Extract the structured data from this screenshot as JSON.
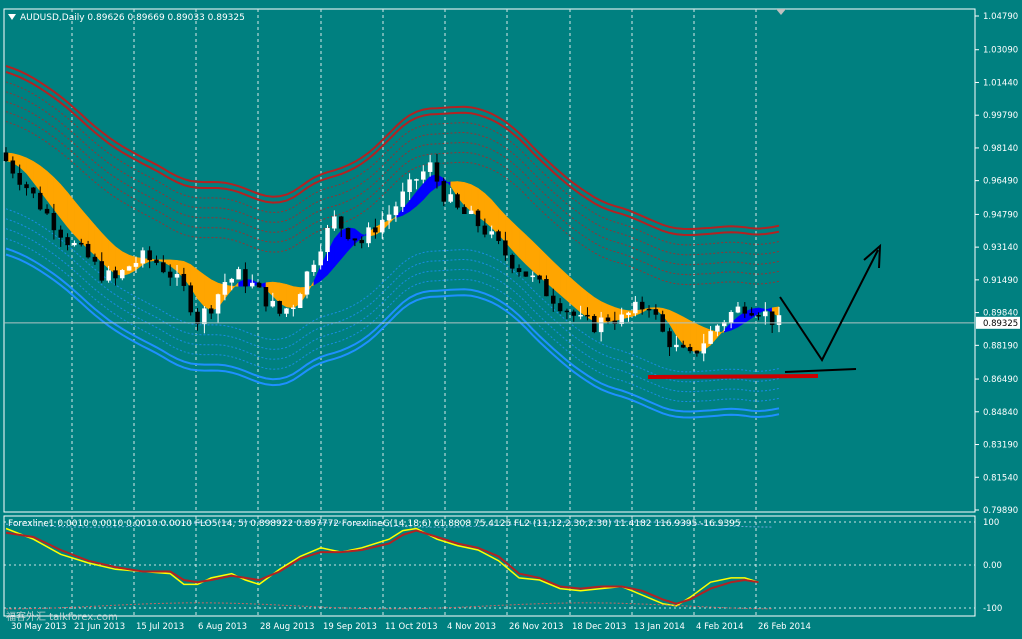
{
  "chart_data": [
    {
      "type": "candlestick",
      "symbol": "AUDUSD,Daily",
      "ohlc_text": "0.89626 0.89669 0.89033 0.89325",
      "current_price": "0.89325",
      "y_tick_labels": [
        "1.04790",
        "1.03090",
        "1.01440",
        "0.99790",
        "0.98140",
        "0.96490",
        "0.94790",
        "0.93140",
        "0.91490",
        "0.89840",
        "0.88190",
        "0.86490",
        "0.84840",
        "0.83190",
        "0.81540",
        "0.79890"
      ],
      "ylim": [
        0.7989,
        1.0479
      ],
      "x_tick_labels": [
        "30 May 2013",
        "21 Jun 2013",
        "15 Jul 2013",
        "6 Aug 2013",
        "28 Aug 2013",
        "19 Sep 2013",
        "11 Oct 2013",
        "4 Nov 2013",
        "26 Nov 2013",
        "18 Dec 2013",
        "13 Jan 2014",
        "4 Feb 2014",
        "26 Feb 2014"
      ],
      "close_path": [
        [
          0,
          0.975
        ],
        [
          3,
          0.962
        ],
        [
          6,
          0.948
        ],
        [
          9,
          0.935
        ],
        [
          12,
          0.926
        ],
        [
          14,
          0.918
        ],
        [
          16,
          0.915
        ],
        [
          18,
          0.922
        ],
        [
          20,
          0.926
        ],
        [
          22,
          0.924
        ],
        [
          24,
          0.918
        ],
        [
          26,
          0.91
        ],
        [
          28,
          0.895
        ],
        [
          30,
          0.902
        ],
        [
          32,
          0.914
        ],
        [
          34,
          0.917
        ],
        [
          36,
          0.912
        ],
        [
          38,
          0.905
        ],
        [
          40,
          0.898
        ],
        [
          42,
          0.903
        ],
        [
          44,
          0.918
        ],
        [
          46,
          0.933
        ],
        [
          48,
          0.945
        ],
        [
          50,
          0.939
        ],
        [
          52,
          0.934
        ],
        [
          54,
          0.942
        ],
        [
          56,
          0.948
        ],
        [
          58,
          0.957
        ],
        [
          60,
          0.966
        ],
        [
          62,
          0.972
        ],
        [
          64,
          0.958
        ],
        [
          66,
          0.95
        ],
        [
          68,
          0.946
        ],
        [
          70,
          0.94
        ],
        [
          72,
          0.932
        ],
        [
          74,
          0.924
        ],
        [
          76,
          0.918
        ],
        [
          78,
          0.912
        ],
        [
          80,
          0.906
        ],
        [
          82,
          0.9
        ],
        [
          84,
          0.894
        ],
        [
          86,
          0.892
        ],
        [
          88,
          0.896
        ],
        [
          90,
          0.895
        ],
        [
          92,
          0.9
        ],
        [
          94,
          0.903
        ],
        [
          96,
          0.888
        ],
        [
          98,
          0.88
        ],
        [
          100,
          0.876
        ],
        [
          102,
          0.884
        ],
        [
          104,
          0.892
        ],
        [
          106,
          0.898
        ],
        [
          108,
          0.902
        ],
        [
          110,
          0.9
        ],
        [
          112,
          0.895
        ],
        [
          113,
          0.893
        ]
      ]
    },
    {
      "type": "line",
      "header_text": "Forexline1 0.0010 0.0010 0.0010 0.0010  FLO5(14, 5)  0.898922  0.897772  ForexlineG(14,18,6) 61.8808 75.4125  FL2 (11,12,2.30,2.30) 11.4182 116.9395  -16.9395",
      "y_tick_labels": [
        "100",
        "0.00",
        "-100"
      ],
      "ylim": [
        -100,
        100
      ],
      "series": [
        {
          "name": "",
          "values": [
            [
              0,
              85
            ],
            [
              4,
              60
            ],
            [
              8,
              25
            ],
            [
              12,
              5
            ],
            [
              16,
              -10
            ],
            [
              20,
              -15
            ],
            [
              24,
              -20
            ],
            [
              26,
              -45
            ],
            [
              28,
              -45
            ],
            [
              30,
              -30
            ],
            [
              33,
              -20
            ],
            [
              35,
              -35
            ],
            [
              37,
              -45
            ],
            [
              40,
              -10
            ],
            [
              43,
              20
            ],
            [
              46,
              40
            ],
            [
              49,
              30
            ],
            [
              52,
              40
            ],
            [
              56,
              60
            ],
            [
              58,
              80
            ],
            [
              60,
              85
            ],
            [
              63,
              60
            ],
            [
              66,
              45
            ],
            [
              69,
              35
            ],
            [
              72,
              10
            ],
            [
              75,
              -30
            ],
            [
              78,
              -35
            ],
            [
              81,
              -55
            ],
            [
              84,
              -60
            ],
            [
              87,
              -55
            ],
            [
              90,
              -50
            ],
            [
              93,
              -70
            ],
            [
              96,
              -90
            ],
            [
              98,
              -95
            ],
            [
              100,
              -75
            ],
            [
              103,
              -40
            ],
            [
              106,
              -30
            ],
            [
              108,
              -30
            ],
            [
              110,
              -40
            ]
          ]
        },
        {
          "name": "",
          "values": [
            [
              0,
              75
            ],
            [
              4,
              65
            ],
            [
              8,
              35
            ],
            [
              12,
              10
            ],
            [
              16,
              -5
            ],
            [
              20,
              -15
            ],
            [
              24,
              -15
            ],
            [
              26,
              -35
            ],
            [
              28,
              -40
            ],
            [
              30,
              -35
            ],
            [
              33,
              -25
            ],
            [
              35,
              -30
            ],
            [
              37,
              -35
            ],
            [
              40,
              -15
            ],
            [
              43,
              15
            ],
            [
              46,
              30
            ],
            [
              49,
              30
            ],
            [
              52,
              35
            ],
            [
              56,
              50
            ],
            [
              58,
              70
            ],
            [
              60,
              80
            ],
            [
              63,
              65
            ],
            [
              66,
              50
            ],
            [
              69,
              40
            ],
            [
              72,
              20
            ],
            [
              75,
              -20
            ],
            [
              78,
              -30
            ],
            [
              81,
              -50
            ],
            [
              84,
              -55
            ],
            [
              87,
              -50
            ],
            [
              90,
              -50
            ],
            [
              93,
              -60
            ],
            [
              96,
              -80
            ],
            [
              98,
              -90
            ],
            [
              100,
              -80
            ],
            [
              103,
              -55
            ],
            [
              106,
              -40
            ],
            [
              108,
              -35
            ],
            [
              110,
              -40
            ]
          ]
        }
      ]
    }
  ],
  "colors": {
    "background": "#008080",
    "grid": "#d8e8e8",
    "bull_candle": "#ffffff",
    "bear_candle": "#000000",
    "orange_band": "#ffa500",
    "blue_band": "#0000ff",
    "upper_envelope": "#b22222",
    "lower_envelope": "#1e90ff",
    "support_line": "#cc0000",
    "arrow": "#000000",
    "osc_yellow": "#ffff00",
    "osc_red": "#b22222"
  },
  "watermark": "福客外汇 talkforex.com"
}
